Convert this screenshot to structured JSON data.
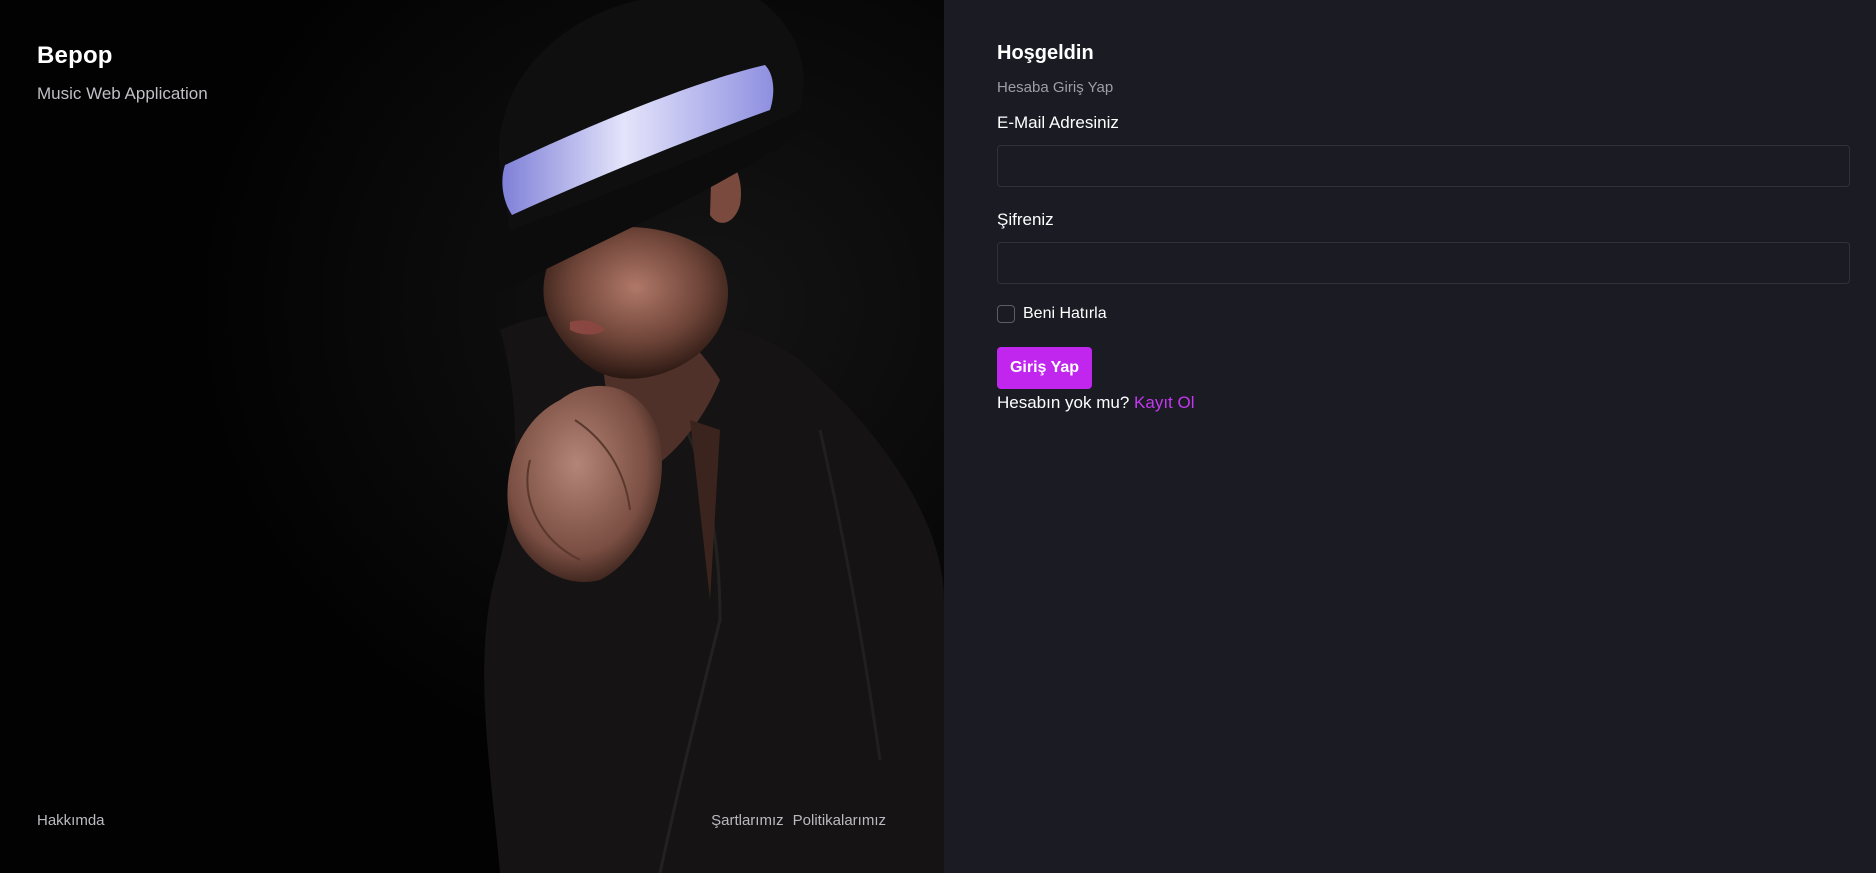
{
  "brand": {
    "title": "Bepop",
    "subtitle": "Music Web Application"
  },
  "hero_footer": {
    "about": "Hakkımda",
    "terms": "Şartlarımız",
    "policies": "Politikalarımız"
  },
  "login": {
    "title": "Hoşgeldin",
    "subtitle": "Hesaba Giriş Yap",
    "email_label": "E-Mail Adresiniz",
    "email_value": "",
    "password_label": "Şifreniz",
    "password_value": "",
    "remember_label": "Beni Hatırla",
    "remember_checked": false,
    "submit_label": "Giriş Yap",
    "no_account_text": "Hesabın yok mu?",
    "signup_link": "Kayıt Ol"
  },
  "colors": {
    "accent": "#c026ee",
    "panel_background": "#1a1b23",
    "hero_background": "#020202"
  }
}
